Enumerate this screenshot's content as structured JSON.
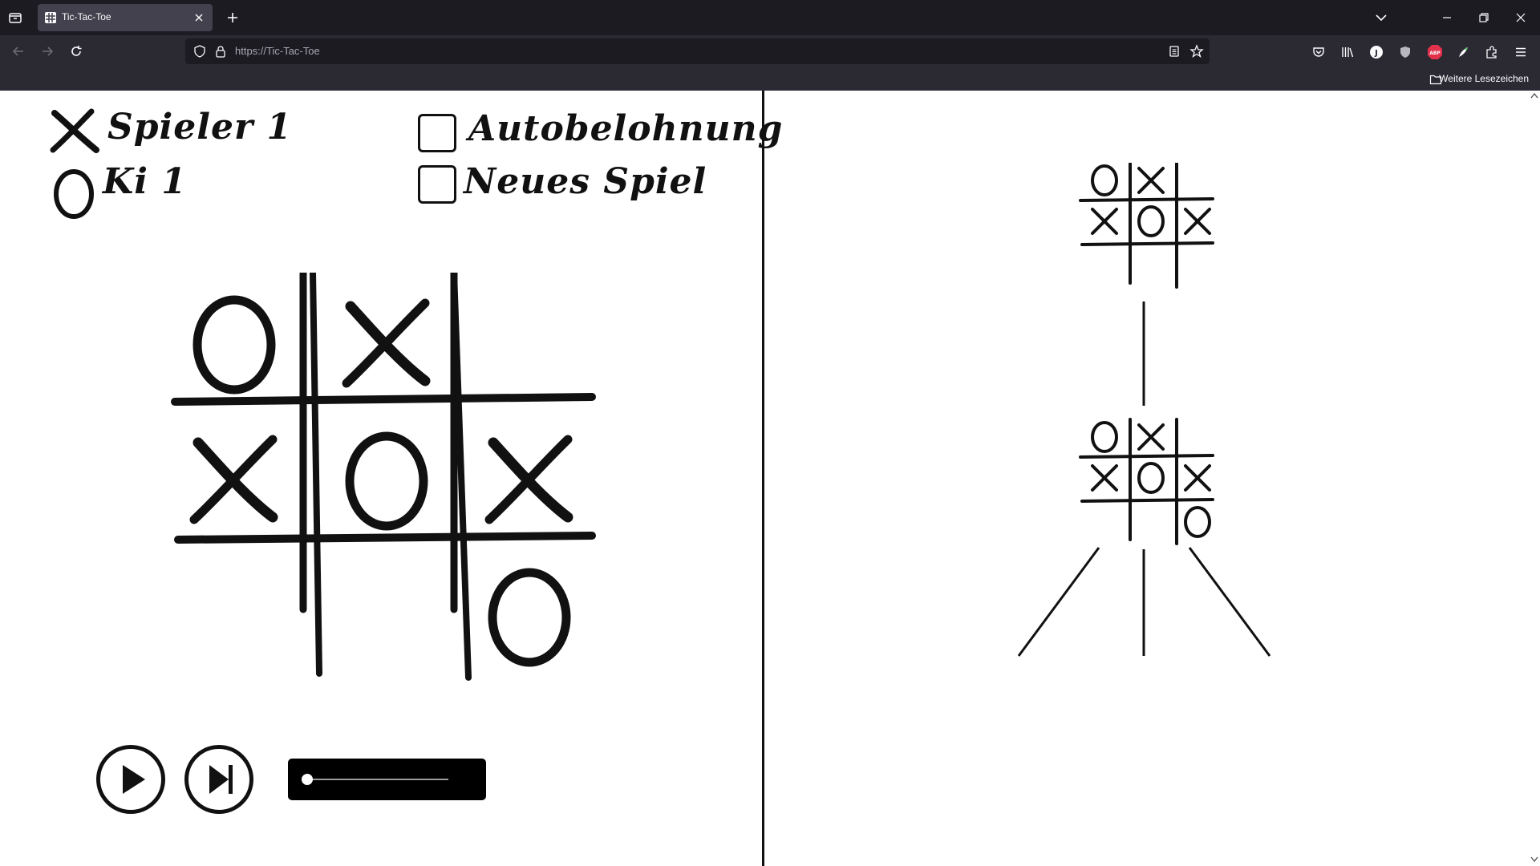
{
  "browser": {
    "tab_title": "Tic-Tac-Toe",
    "url": "https://Tic-Tac-Toe",
    "bookmarks_label": "Weitere Lesezeichen",
    "colors": {
      "tabbar": "#1c1b22",
      "navbar": "#2b2a33",
      "text": "#fbfbfe"
    }
  },
  "game": {
    "player_label": "Spieler 1",
    "ai_label": "Ki 1",
    "auto_reward_label": "Autobelohnung",
    "new_game_label": "Neues Spiel",
    "board": [
      "O",
      "X",
      "",
      "X",
      "O",
      "X",
      "",
      "",
      "O"
    ],
    "play_icon": "play-icon",
    "step_icon": "step-forward-icon",
    "slider_value": 0
  },
  "tree": {
    "root_board": [
      "O",
      "X",
      "",
      "X",
      "O",
      "X",
      "",
      "",
      ""
    ],
    "child_board": [
      "O",
      "X",
      "",
      "X",
      "O",
      "X",
      "",
      "",
      "O"
    ]
  }
}
